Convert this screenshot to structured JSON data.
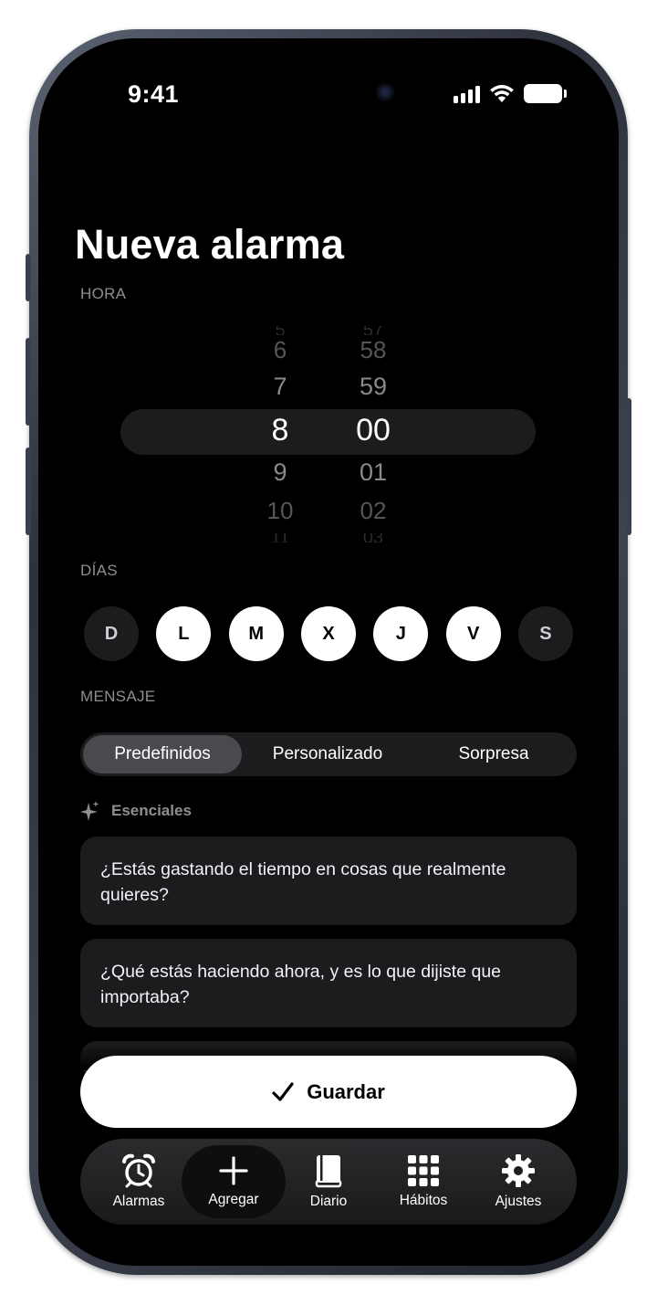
{
  "status_bar": {
    "time": "9:41"
  },
  "page": {
    "title": "Nueva alarma"
  },
  "time_picker": {
    "label": "HORA",
    "hours": {
      "above2": "6",
      "above1": "7",
      "selected": "8",
      "below1": "9",
      "below2": "10"
    },
    "minutes": {
      "above2": "58",
      "above1": "59",
      "selected": "00",
      "below1": "01",
      "below2": "02"
    }
  },
  "days": {
    "label": "DÍAS",
    "items": [
      {
        "label": "D",
        "selected": false
      },
      {
        "label": "L",
        "selected": true
      },
      {
        "label": "M",
        "selected": true
      },
      {
        "label": "X",
        "selected": true
      },
      {
        "label": "J",
        "selected": true
      },
      {
        "label": "V",
        "selected": true
      },
      {
        "label": "S",
        "selected": false
      }
    ]
  },
  "message": {
    "label": "MENSAJE",
    "segments": [
      "Predefinidos",
      "Personalizado",
      "Sorpresa"
    ],
    "active_segment": "Predefinidos",
    "category": "Esenciales",
    "items": [
      "¿Estás gastando el tiempo en cosas que realmente quieres?",
      "¿Qué estás haciendo ahora, y es lo que dijiste que importaba?"
    ]
  },
  "save_button": {
    "label": "Guardar",
    "icon": "checkmark-icon"
  },
  "tab_bar": {
    "active": "Agregar",
    "items": [
      {
        "label": "Alarmas",
        "icon": "alarm-clock-icon"
      },
      {
        "label": "Agregar",
        "icon": "plus-icon"
      },
      {
        "label": "Diario",
        "icon": "book-icon"
      },
      {
        "label": "Hábitos",
        "icon": "grid-icon"
      },
      {
        "label": "Ajustes",
        "icon": "gear-icon"
      }
    ]
  },
  "colors": {
    "background": "#000000",
    "surface": "#1c1c1e",
    "active_segment": "#4a4a4e",
    "secondary_text": "#8e8e93",
    "primary": "#ffffff"
  }
}
